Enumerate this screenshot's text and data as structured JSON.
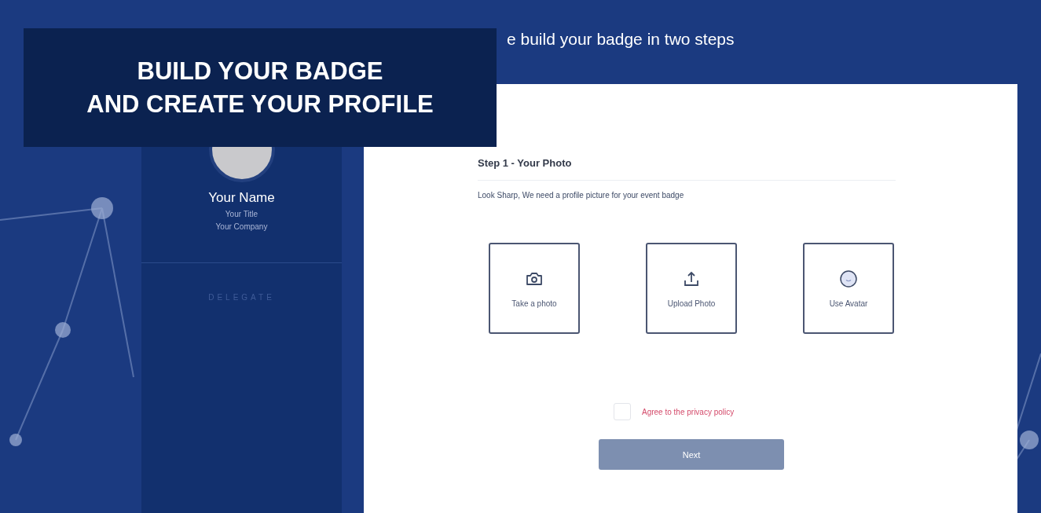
{
  "heading": "e build your badge in two steps",
  "banner": {
    "lines": [
      "BUILD YOUR BADGE",
      "AND CREATE YOUR PROFILE"
    ]
  },
  "badge": {
    "name": "Your Name",
    "title": "Your Title",
    "company": "Your Company",
    "role": "DELEGATE"
  },
  "step": {
    "title": "Step 1 - Your Photo",
    "subtitle": "Look Sharp, We need a profile picture for your event badge",
    "options": [
      {
        "kind": "camera",
        "label": "Take a photo"
      },
      {
        "kind": "upload",
        "label": "Upload Photo"
      },
      {
        "kind": "avatar",
        "label": "Use Avatar"
      }
    ]
  },
  "privacy": {
    "label": "Agree to the privacy policy",
    "checked": false
  },
  "next": {
    "label": "Next",
    "disabled": true
  }
}
